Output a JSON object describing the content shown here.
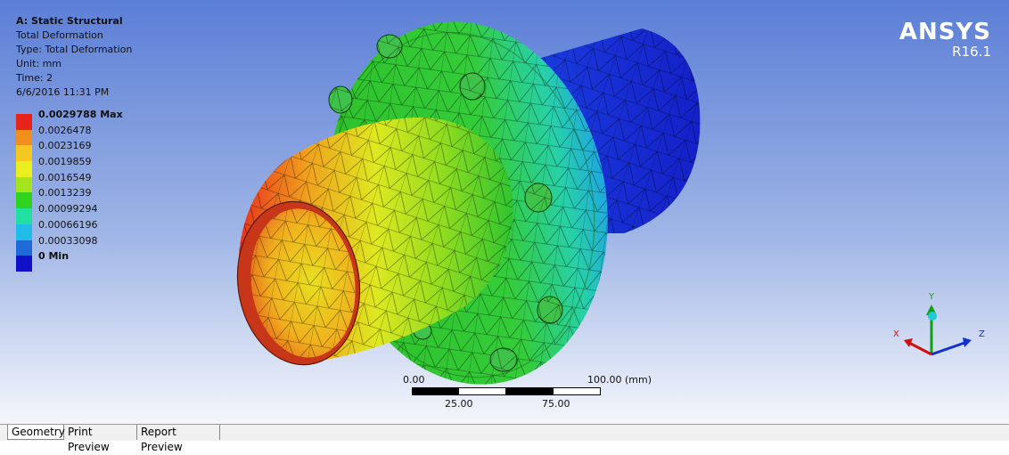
{
  "info": {
    "title": "A: Static Structural",
    "result": "Total Deformation",
    "type": "Type: Total Deformation",
    "unit": "Unit: mm",
    "time": "Time: 2",
    "date": "6/6/2016 11:31 PM"
  },
  "legend": [
    {
      "label": "0.0029788 Max",
      "color": "#e8231c",
      "bold": true
    },
    {
      "label": "0.0026478",
      "color": "#f08f1c"
    },
    {
      "label": "0.0023169",
      "color": "#f5c81f"
    },
    {
      "label": "0.0019859",
      "color": "#eaf01f"
    },
    {
      "label": "0.0016549",
      "color": "#a3e41e"
    },
    {
      "label": "0.0013239",
      "color": "#2fd21f"
    },
    {
      "label": "0.00099294",
      "color": "#22e0a2"
    },
    {
      "label": "0.00066196",
      "color": "#1fbde8"
    },
    {
      "label": "0.00033098",
      "color": "#1f6ad8"
    },
    {
      "label": "0 Min",
      "color": "#1010c8",
      "bold": true
    }
  ],
  "logo": {
    "brand": "ANSYS",
    "version": "R16.1"
  },
  "scale_bar": {
    "left": "0.00",
    "right": "100.00 (mm)",
    "mid1": "25.00",
    "mid2": "75.00"
  },
  "triad": {
    "x": "X",
    "y": "Y",
    "z": "Z"
  },
  "tabs": [
    {
      "label": "Geometry",
      "active": true
    },
    {
      "label": "Print Preview",
      "active": false
    },
    {
      "label": "Report Preview",
      "active": false
    }
  ],
  "colors": {
    "x_axis": "#d01010",
    "y_axis": "#10a010",
    "z_axis": "#1030d0"
  }
}
